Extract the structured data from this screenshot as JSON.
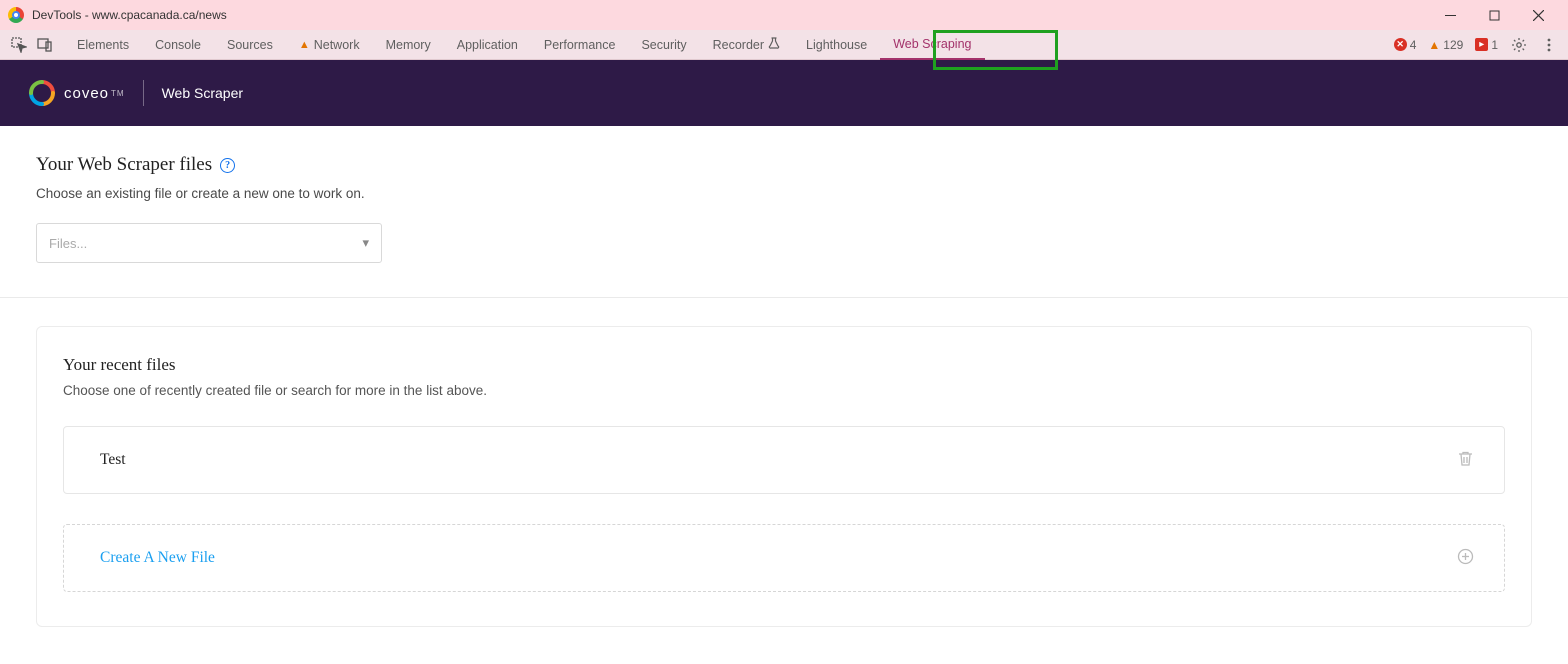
{
  "window": {
    "title": "DevTools - www.cpacanada.ca/news"
  },
  "devtools": {
    "tabs": [
      "Elements",
      "Console",
      "Sources",
      "Network",
      "Memory",
      "Application",
      "Performance",
      "Security",
      "Recorder",
      "Lighthouse",
      "Web Scraping"
    ],
    "network_has_warning": true,
    "recorder_has_flask": true,
    "active_tab": "Web Scraping",
    "errors_count": "4",
    "warnings_count": "129",
    "issues_count": "1"
  },
  "app": {
    "brand": "coveo",
    "trademark": "TM",
    "title": "Web Scraper"
  },
  "section1": {
    "title": "Your Web Scraper files",
    "subtitle": "Choose an existing file or create a new one to work on.",
    "dropdown_placeholder": "Files..."
  },
  "recent": {
    "title": "Your recent files",
    "subtitle": "Choose one of recently created file or search for more in the list above.",
    "items": [
      {
        "name": "Test"
      }
    ],
    "new_file_label": "Create A New File"
  }
}
